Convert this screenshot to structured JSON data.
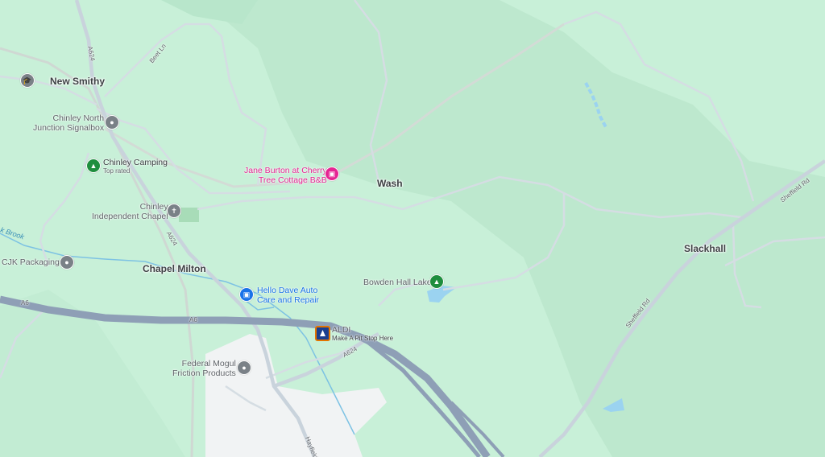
{
  "map": {
    "colors": {
      "land": "#c8f0d8",
      "forest": "#bde8ce",
      "urban": "#f1f3f4",
      "water": "#9bd3f0",
      "major_road": "#8e9fb6",
      "minor_road": "#d5dde3"
    },
    "places": [
      {
        "name": "New Smithy"
      },
      {
        "name": "Wash"
      },
      {
        "name": "Chapel Milton"
      },
      {
        "name": "Slackhall"
      }
    ],
    "pois": [
      {
        "name": "Chinley North Junction Signalbox",
        "line1": "Chinley North",
        "line2": "Junction Signalbox",
        "icon": "landmark-icon"
      },
      {
        "name": "Chinley Camping",
        "subtitle": "Top rated",
        "icon": "campground-icon"
      },
      {
        "name": "Jane Burton at Cherry Tree Cottage B&B",
        "line1": "Jane Burton at Cherry",
        "line2": "Tree Cottage B&B",
        "icon": "bed-icon"
      },
      {
        "name": "Chinley Independent Chapel",
        "line1": "Chinley",
        "line2": "Independent Chapel",
        "icon": "church-icon"
      },
      {
        "name": "CJK Packaging",
        "icon": "business-icon"
      },
      {
        "name": "Bowden Hall Lake",
        "icon": "tree-icon"
      },
      {
        "name": "Hello Dave Auto Care and Repair",
        "line1": "Hello Dave Auto",
        "line2": "Care and Repair",
        "icon": "shopping-bag-icon"
      },
      {
        "name": "ALDI",
        "subtitle": "Make A Pit Stop Here",
        "icon": "aldi-logo-icon"
      },
      {
        "name": "Federal Mogul Friction Products",
        "line1": "Federal Mogul",
        "line2": "Friction Products",
        "icon": "factory-icon"
      }
    ],
    "roads": [
      {
        "label": "A624"
      },
      {
        "label": "Beet Ln"
      },
      {
        "label": "A624"
      },
      {
        "label": "A6"
      },
      {
        "label": "A6"
      },
      {
        "label": "A624"
      },
      {
        "label": "Sheffield Rd"
      },
      {
        "label": "Sheffield Rd"
      },
      {
        "label": "Hayfield"
      }
    ],
    "water_labels": [
      {
        "label": "k Brook"
      }
    ]
  }
}
